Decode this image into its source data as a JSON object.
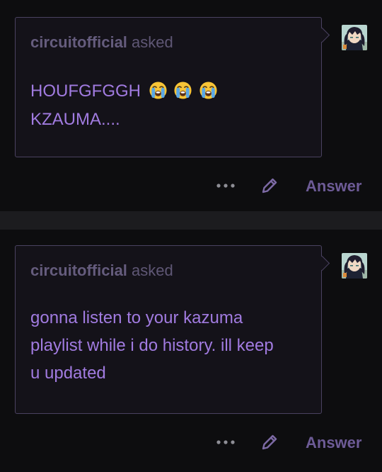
{
  "colors": {
    "background": "#0d0d0f",
    "separator": "#1c1c1f",
    "bubble": "#141219",
    "bubble_border": "#4a4260",
    "question_text": "#a17be0",
    "muted_text": "#655c7d",
    "answer_button": "#6d5b96"
  },
  "posts": [
    {
      "asker": "circuitofficial",
      "asked_label": "asked",
      "question_lines": [
        "HOUFGFGGH",
        "KZAUMA...."
      ],
      "emoji": "loudly-crying-face-emoji x3",
      "actions": {
        "more_icon": "more-horizontal-icon",
        "edit_icon": "pencil-icon",
        "answer_label": "Answer"
      }
    },
    {
      "asker": "circuitofficial",
      "asked_label": "asked",
      "question_lines": [
        "gonna listen to your kazuma",
        "playlist while i do history. ill keep",
        "u updated"
      ],
      "actions": {
        "more_icon": "more-horizontal-icon",
        "edit_icon": "pencil-icon",
        "answer_label": "Answer"
      }
    }
  ]
}
